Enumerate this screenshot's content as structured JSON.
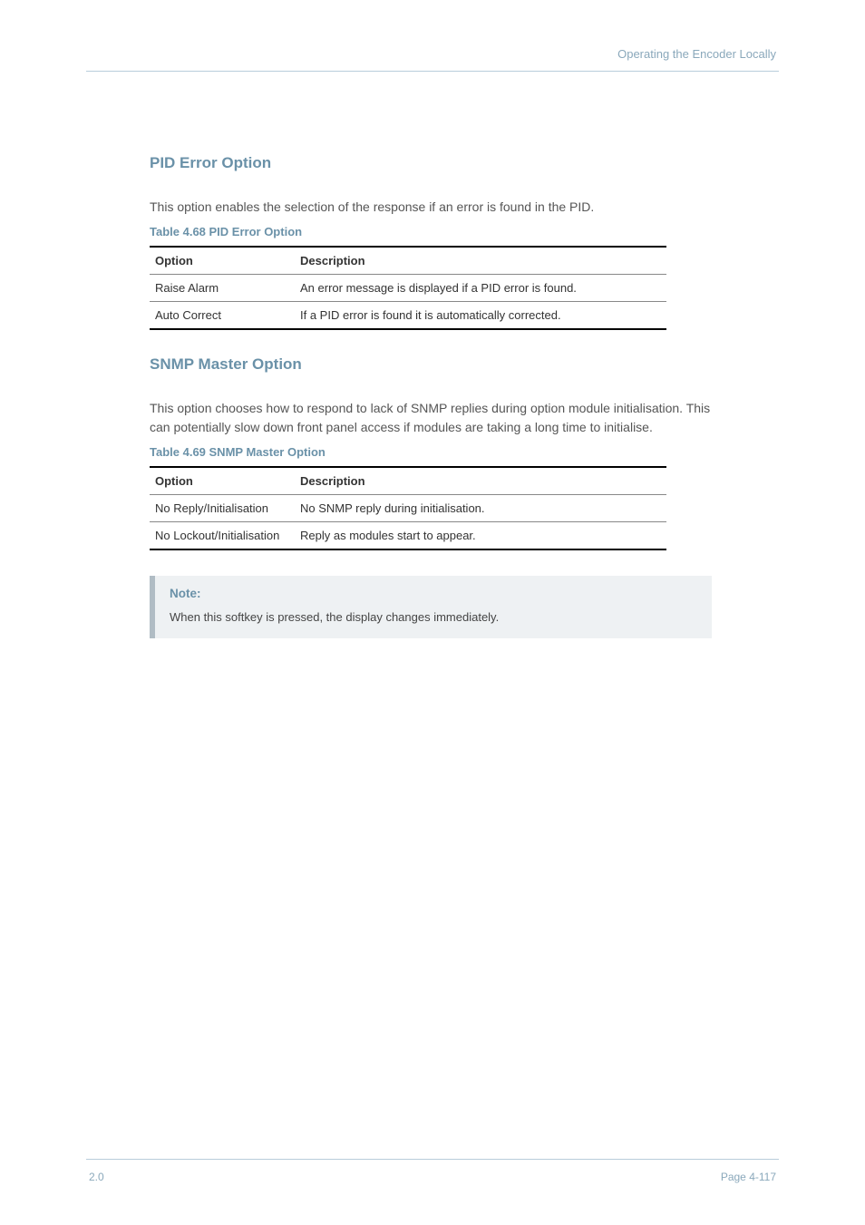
{
  "header_right": "Operating the Encoder Locally",
  "section_a": {
    "heading": "PID Error Option",
    "text": "This option enables the selection of the response if an error is found in the PID.",
    "table_caption": "Table 4.68 PID Error Option",
    "col1": "Option",
    "col2": "Description",
    "rows": [
      {
        "opt": "Raise Alarm",
        "desc": "An error message is displayed if a PID error is found."
      },
      {
        "opt": "Auto Correct",
        "desc": "If a PID error is found it is automatically corrected."
      }
    ]
  },
  "section_b": {
    "heading": "SNMP Master Option",
    "text": "This option chooses how to respond to lack of SNMP replies during option module initialisation. This can potentially slow down front panel access if modules are taking a long time to initialise.",
    "table_caption": "Table 4.69 SNMP Master Option",
    "col1": "Option",
    "col2": "Description",
    "rows": [
      {
        "opt": "No Reply/Initialisation",
        "desc": "No SNMP reply during initialisation."
      },
      {
        "opt": "No Lockout/Initialisation",
        "desc": "Reply as modules start to appear."
      }
    ]
  },
  "note": {
    "title": "Note:",
    "body": "When this softkey is pressed, the display changes immediately."
  },
  "footer_left": "2.0",
  "footer_right": "Page 4-117"
}
